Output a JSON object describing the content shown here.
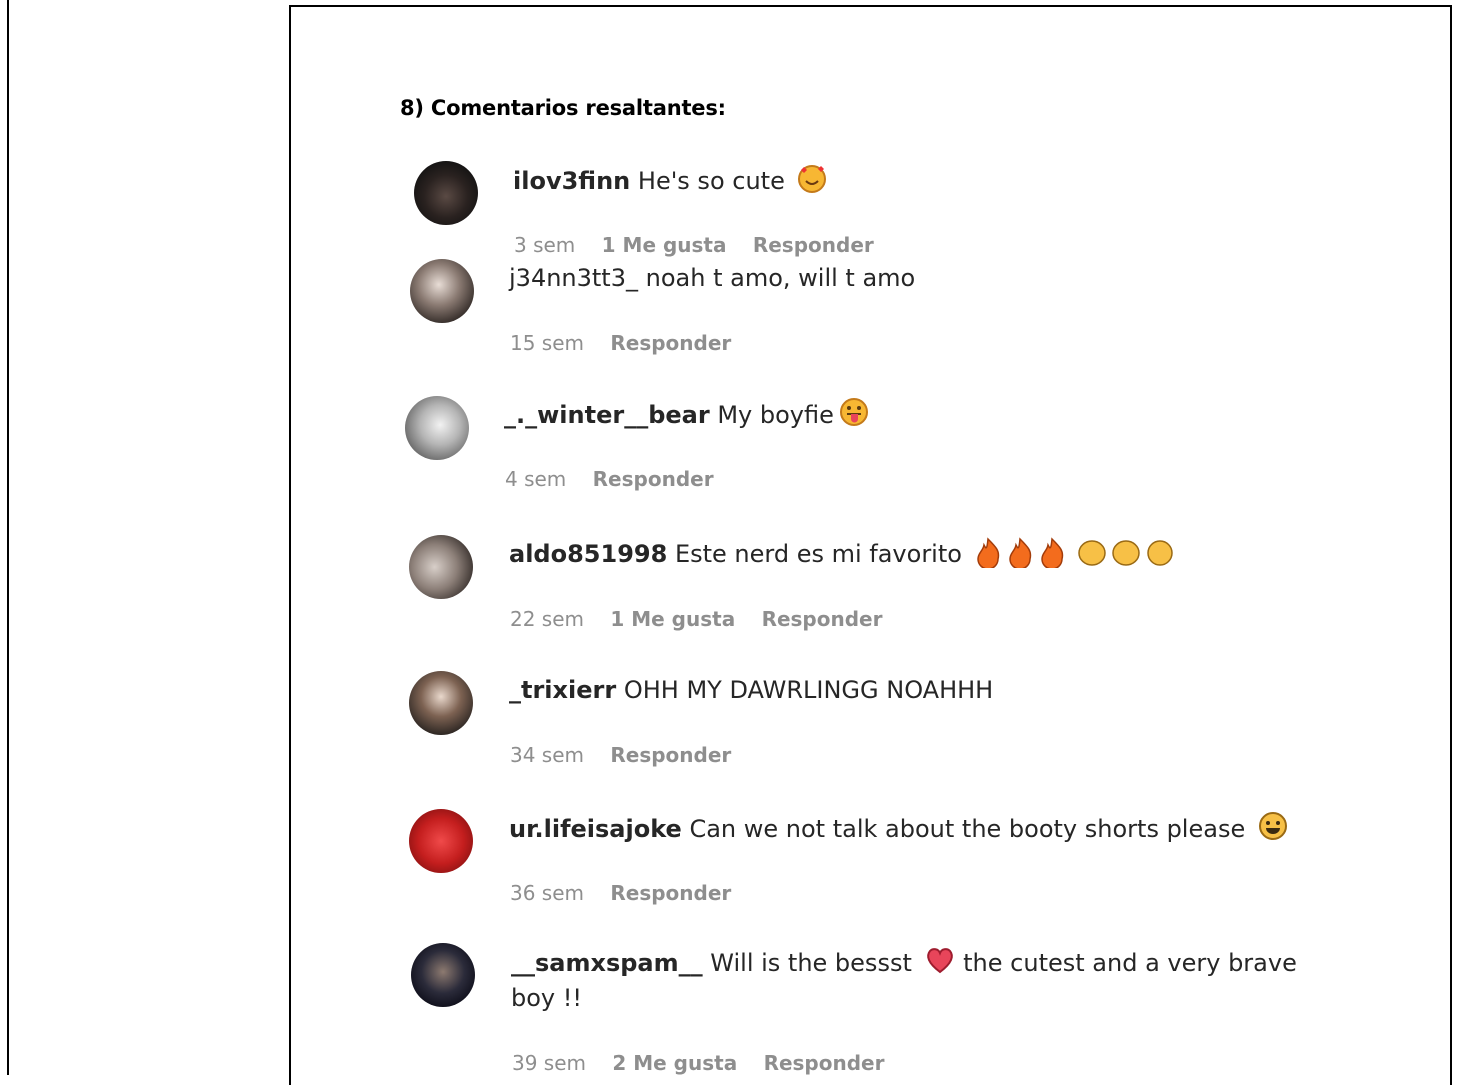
{
  "section_title": "8) Comentarios resaltantes:",
  "comments": [
    {
      "username": "ilov3finn",
      "text": "He's so cute",
      "emoji": "smiling-face-with-hearts-icon",
      "time": "3 sem",
      "likes": "1 Me gusta",
      "reply": "Responder"
    },
    {
      "username": "j34nn3tt3_",
      "text": "noah t amo, will t amo",
      "time": "15 sem",
      "reply": "Responder"
    },
    {
      "username": "_._winter__bear",
      "text": "My boyfie",
      "emoji": "tongue-face-icon",
      "time": "4 sem",
      "reply": "Responder"
    },
    {
      "username": "aldo851998",
      "text": "Este nerd es mi favorito",
      "emoji": "fire-and-clap-icons",
      "time": "22 sem",
      "likes": "1 Me gusta",
      "reply": "Responder"
    },
    {
      "username": "_trixierr",
      "text": "OHH MY DAWRLINGG NOAHHH",
      "time": "34 sem",
      "reply": "Responder"
    },
    {
      "username": "ur.lifeisajoke",
      "text": "Can we not talk about the booty shorts please",
      "emoji": "grinning-face-icon",
      "time": "36 sem",
      "reply": "Responder"
    },
    {
      "username": "__samxspam__",
      "text_a": "Will is the bessst",
      "text_b": "the cutest and a very brave",
      "text_c": "boy !!",
      "emoji": "heart-icon",
      "time": "39 sem",
      "likes": "2 Me gusta",
      "reply": "Responder"
    }
  ]
}
